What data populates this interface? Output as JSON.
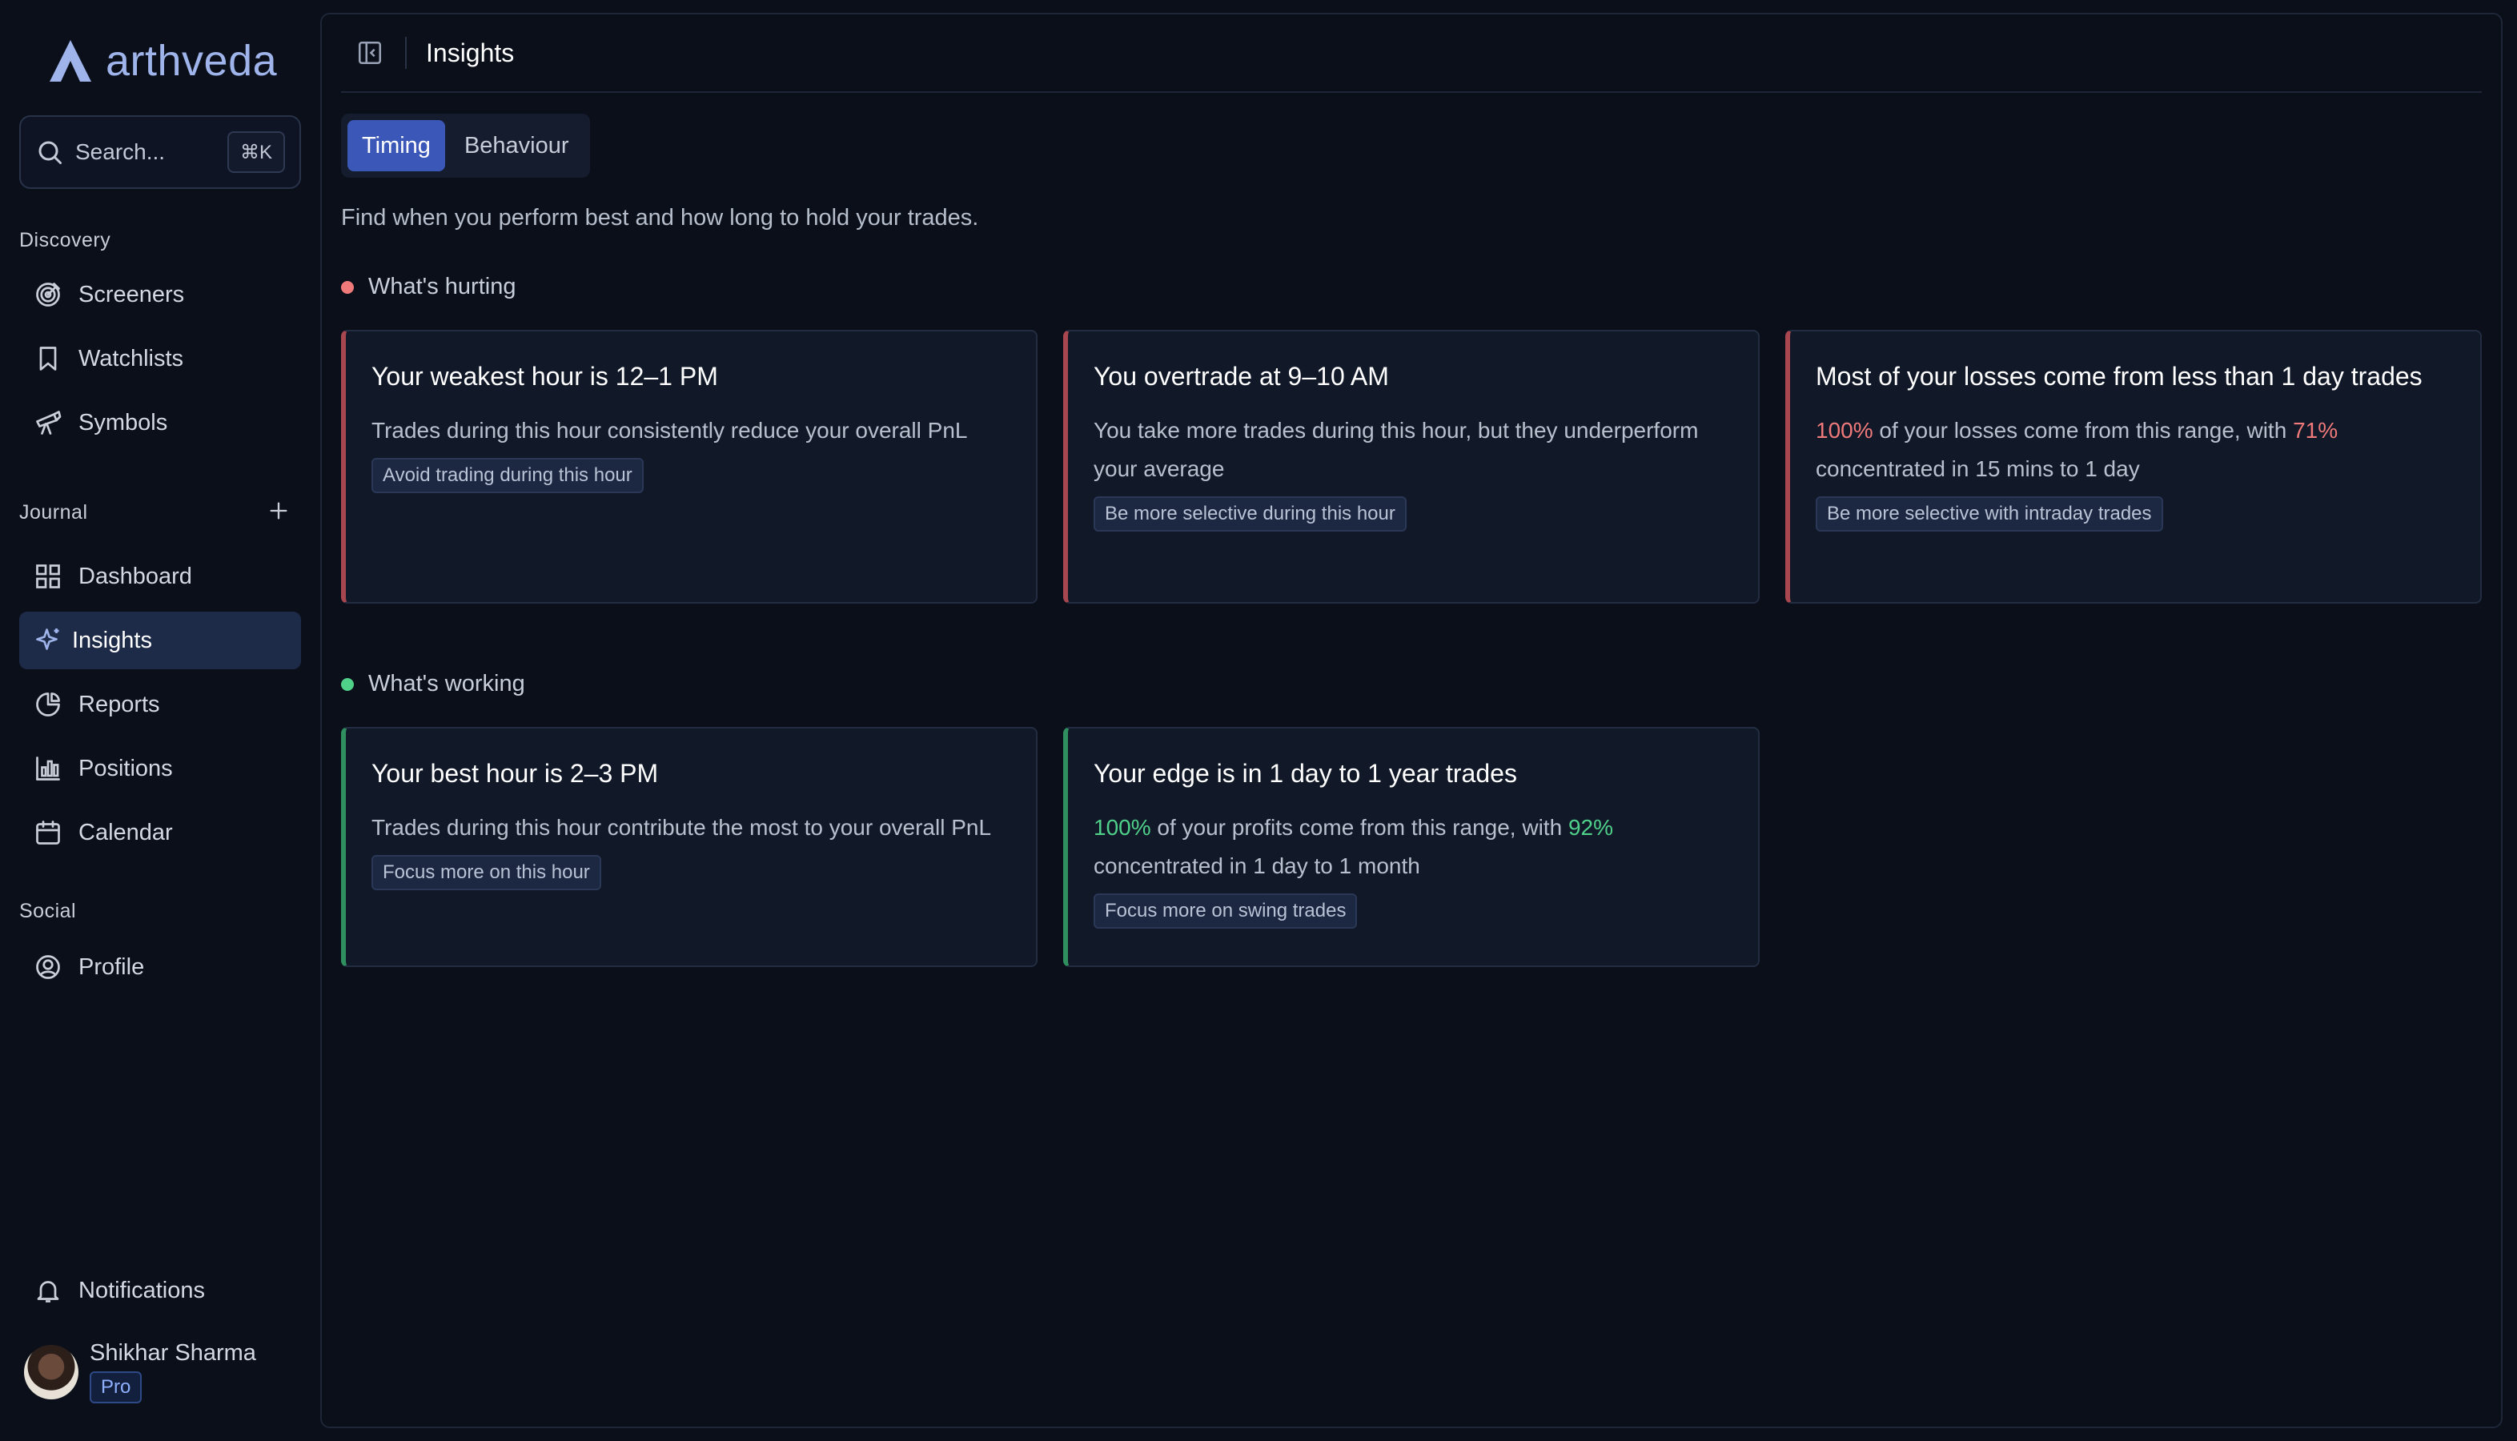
{
  "brand": {
    "name": "arthveda"
  },
  "search": {
    "placeholder": "Search...",
    "shortcut": "⌘K"
  },
  "sidebar": {
    "sections": {
      "discovery": "Discovery",
      "journal": "Journal",
      "social": "Social"
    },
    "discovery_items": [
      {
        "label": "Screeners",
        "icon": "target-icon"
      },
      {
        "label": "Watchlists",
        "icon": "bookmark-icon"
      },
      {
        "label": "Symbols",
        "icon": "telescope-icon"
      }
    ],
    "journal_items": [
      {
        "label": "Dashboard",
        "icon": "grid-icon"
      },
      {
        "label": "Insights",
        "icon": "sparkle-icon",
        "active": true
      },
      {
        "label": "Reports",
        "icon": "pie-chart-icon"
      },
      {
        "label": "Positions",
        "icon": "bar-chart-icon"
      },
      {
        "label": "Calendar",
        "icon": "calendar-icon"
      }
    ],
    "social_items": [
      {
        "label": "Profile",
        "icon": "user-circle-icon"
      }
    ],
    "notifications": {
      "label": "Notifications",
      "icon": "bell-icon"
    },
    "user": {
      "name": "Shikhar Sharma",
      "plan": "Pro"
    }
  },
  "header": {
    "title": "Insights"
  },
  "tabs": [
    {
      "label": "Timing",
      "active": true
    },
    {
      "label": "Behaviour",
      "active": false
    }
  ],
  "intro": "Find when you perform best and how long to hold your trades.",
  "hurting": {
    "label": "What's hurting",
    "cards": [
      {
        "title": "Your weakest hour is 12–1 PM",
        "body": "Trades during this hour consistently reduce your overall PnL",
        "action": "Avoid trading during this hour"
      },
      {
        "title": "You overtrade at 9–10 AM",
        "body": "You take more trades during this hour, but they underperform your average",
        "action": "Be more selective during this hour"
      },
      {
        "title": "Most of your losses come from less than 1 day trades",
        "pct1": "100%",
        "body_a": " of your losses come from this range, with ",
        "pct2": "71%",
        "body_b": " concentrated in 15 mins to 1 day",
        "action": "Be more selective with intraday trades"
      }
    ]
  },
  "working": {
    "label": "What's working",
    "cards": [
      {
        "title": "Your best hour is 2–3 PM",
        "body": "Trades during this hour contribute the most to your overall PnL",
        "action": "Focus more on this hour"
      },
      {
        "title": "Your edge is in 1 day to 1 year trades",
        "pct1": "100%",
        "body_a": " of your profits come from this range, with ",
        "pct2": "92%",
        "body_b": " concentrated in 1 day to 1 month",
        "action": "Focus more on swing trades"
      }
    ]
  },
  "colors": {
    "accent": "#3b57b8",
    "negative": "#f07a7a",
    "positive": "#4fd18a",
    "background": "#0a0f1a"
  }
}
